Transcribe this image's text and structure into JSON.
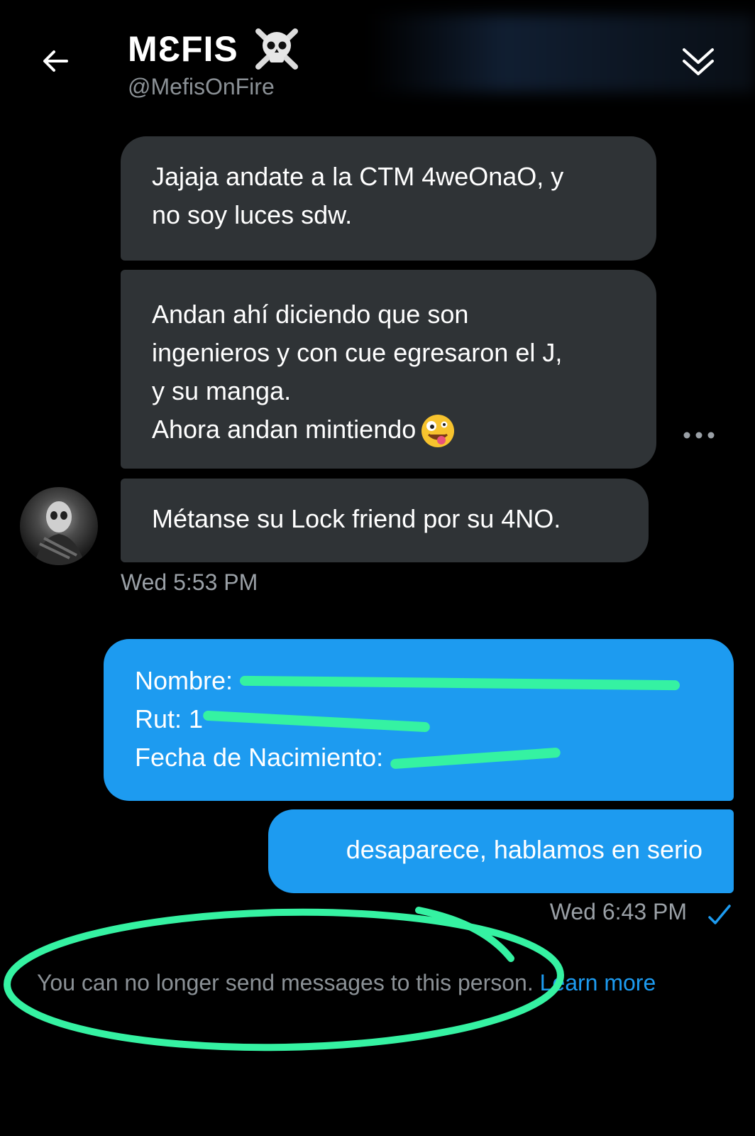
{
  "header": {
    "display_name": "MƐFIS",
    "handle": "@MefisOnFire"
  },
  "messages": {
    "received": [
      {
        "lines": [
          "Jajaja andate a la CTM 4weOnaO, y",
          "no soy luces sdw."
        ]
      },
      {
        "lines": [
          "Andan ahí diciendo que son",
          "ingenieros y con cue egresaron el J,",
          "y su manga.",
          "Ahora andan mintiendo"
        ]
      },
      {
        "lines": [
          "Métanse su Lock friend por su 4NO."
        ]
      }
    ],
    "received_time": "Wed 5:53 PM",
    "sent": [
      {
        "lines": [
          "Nombre: ",
          "Rut: 1",
          "Fecha de Nacimiento:"
        ]
      },
      {
        "lines": [
          "desaparece, hablamos en serio"
        ]
      }
    ],
    "sent_time": "Wed 6:43 PM"
  },
  "notice": {
    "text": "You can no longer send messages to this person.",
    "link": "Learn more"
  },
  "colors": {
    "accent": "#1d9bf0",
    "received_bubble": "#2f3336",
    "annotation": "#35f2a2"
  }
}
